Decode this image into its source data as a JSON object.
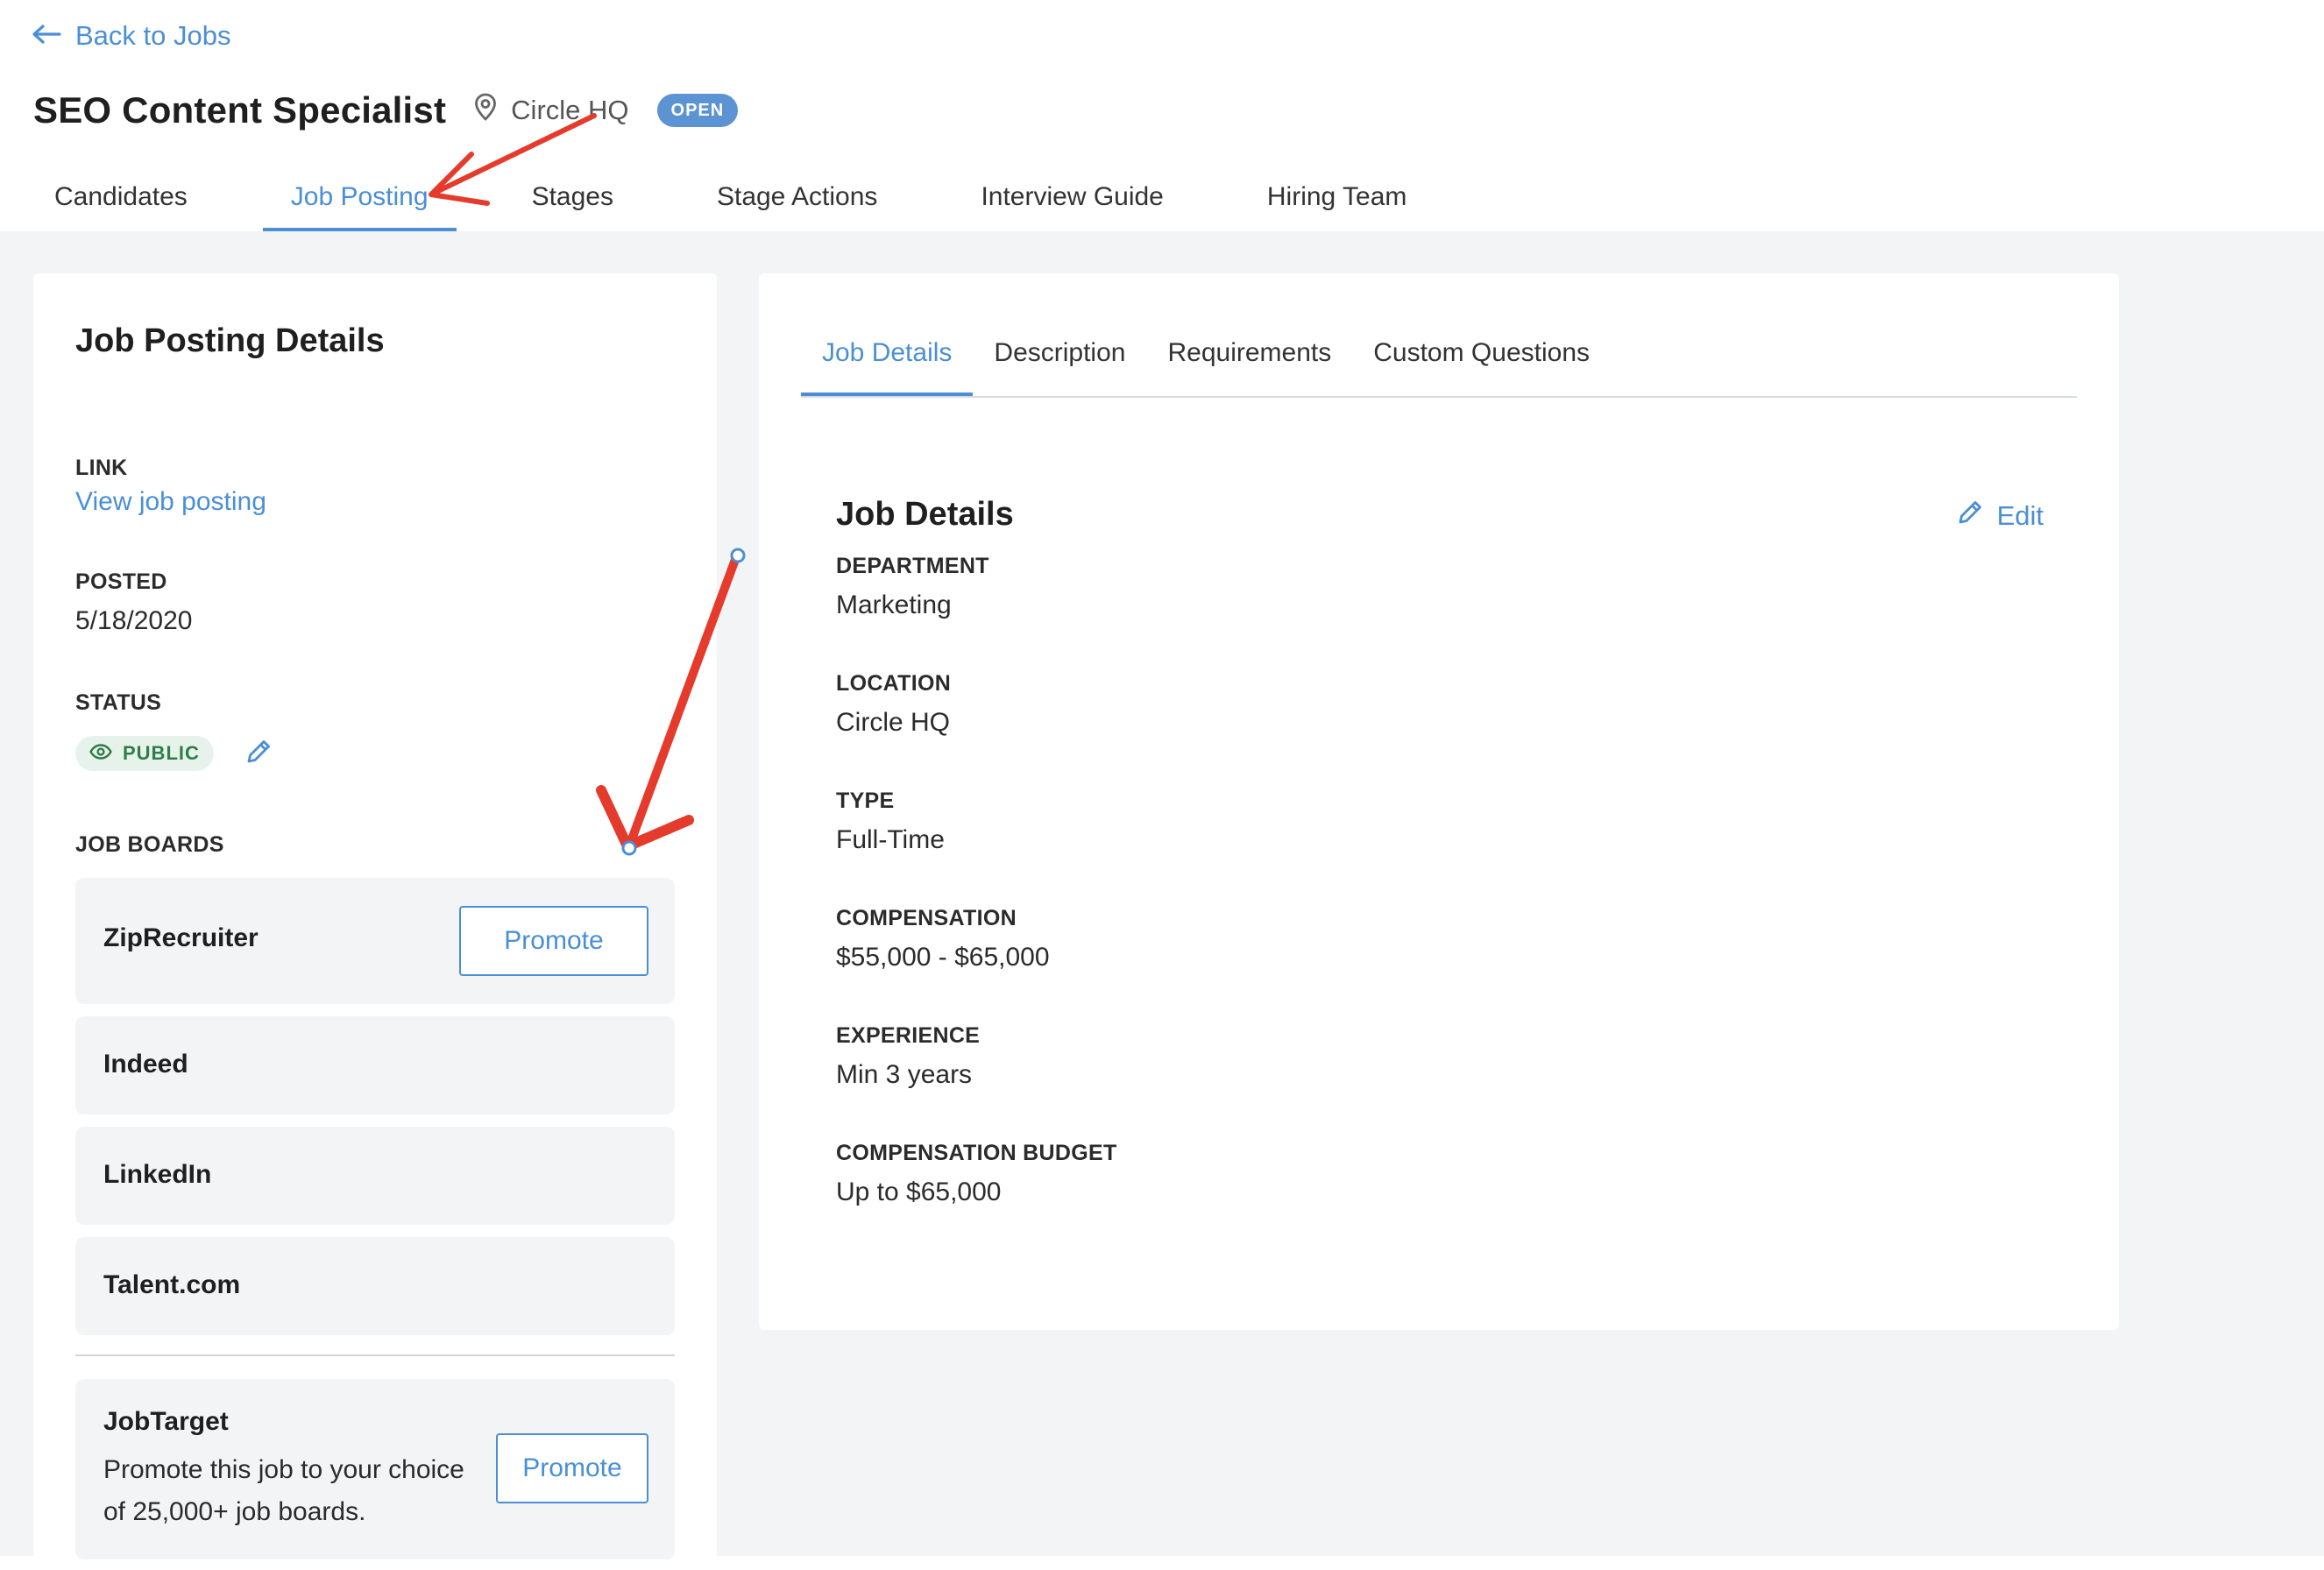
{
  "header": {
    "back_label": "Back to Jobs",
    "job_title": "SEO Content Specialist",
    "location": "Circle HQ",
    "status_badge": "OPEN",
    "tabs": [
      {
        "label": "Candidates"
      },
      {
        "label": "Job Posting",
        "active": true
      },
      {
        "label": "Stages"
      },
      {
        "label": "Stage Actions"
      },
      {
        "label": "Interview Guide"
      },
      {
        "label": "Hiring Team"
      }
    ]
  },
  "posting": {
    "heading": "Job Posting Details",
    "link_label": "LINK",
    "link_text": "View job posting",
    "posted_label": "POSTED",
    "posted_value": "5/18/2020",
    "status_label": "STATUS",
    "status_value": "PUBLIC",
    "boards_label": "JOB BOARDS",
    "boards": [
      {
        "name": "ZipRecruiter",
        "button": "Promote"
      },
      {
        "name": "Indeed"
      },
      {
        "name": "LinkedIn"
      },
      {
        "name": "Talent.com"
      }
    ],
    "jobtarget": {
      "name": "JobTarget",
      "description": "Promote this job to your choice of 25,000+ job boards.",
      "button": "Promote"
    }
  },
  "details": {
    "tabs": [
      {
        "label": "Job Details",
        "active": true
      },
      {
        "label": "Description"
      },
      {
        "label": "Requirements"
      },
      {
        "label": "Custom Questions"
      }
    ],
    "heading": "Job Details",
    "edit_label": "Edit",
    "fields": [
      {
        "label": "DEPARTMENT",
        "value": "Marketing"
      },
      {
        "label": "LOCATION",
        "value": "Circle HQ"
      },
      {
        "label": "TYPE",
        "value": "Full-Time"
      },
      {
        "label": "COMPENSATION",
        "value": "$55,000 - $65,000"
      },
      {
        "label": "EXPERIENCE",
        "value": "Min 3 years"
      },
      {
        "label": "COMPENSATION BUDGET",
        "value": "Up to $65,000"
      }
    ]
  },
  "colors": {
    "accent": "#4a8fd6",
    "open_badge": "#5b93d3",
    "public_badge_bg": "#e7f3ea",
    "public_badge_text": "#2e7d4a",
    "content_bg": "#f3f4f6",
    "annotation_arrow": "#e53b2c"
  },
  "icons": {
    "back": "arrow-left-icon",
    "location": "map-pin-icon",
    "public": "eye-icon",
    "edit": "pencil-icon"
  }
}
